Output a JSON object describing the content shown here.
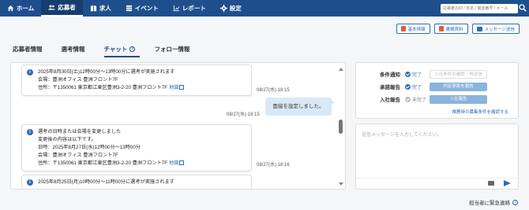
{
  "nav": {
    "items": [
      {
        "label": "ホーム",
        "icon": "home-icon"
      },
      {
        "label": "応募者",
        "icon": "people-icon",
        "active": true
      },
      {
        "label": "求人",
        "icon": "book-icon"
      },
      {
        "label": "イベント",
        "icon": "list-icon"
      },
      {
        "label": "レポート",
        "icon": "chart-icon"
      },
      {
        "label": "設定",
        "icon": "gear-icon"
      }
    ],
    "search_placeholder": "応募者のID / 氏名 / 電話番号 / メール"
  },
  "top_buttons": {
    "basic_info": "基本情報",
    "application_docs": "書類資料",
    "send_message": "メッセージ送信"
  },
  "tabs": {
    "applicant_info": "応募者情報",
    "selection_info": "選考情報",
    "chat": "チャット",
    "follow_info": "フォロー情報"
  },
  "chat": {
    "msg1": {
      "line1": "2025年8月30日(土)12時00分～13時00分に選考が実施されます",
      "line2": "会場：豊洲オフィス 豊洲フロント7F",
      "line3": "住所：〒1350061 東京都江東区豊洲3-2-20 豊洲フロント7F",
      "map": "地図",
      "time": "08/27(水) 18:15"
    },
    "bubble": {
      "text": "面接を設定しました。",
      "time": "08/27(水) 18:15"
    },
    "msg2": {
      "line1": "選考の日時または会場を変更しました",
      "line2": "変更後の内容は以下です。",
      "line3": "日時：2025年8月27日(水)12時00分～13時00分",
      "line4": "会場：豊洲オフィス 豊洲フロント7F",
      "line5": "住所：〒1350061 東京都江東区豊洲3-2-20 豊洲フロント7F",
      "map": "地図",
      "time": "08/27(水) 18:16"
    },
    "msg3": {
      "line1": "2025年8月25日(月)10時00分～11時00分に選考が実施されます"
    }
  },
  "status": {
    "rows": [
      {
        "label": "条件通知",
        "state": "完了",
        "done": true,
        "button": "入社条件の確認・再送信",
        "enabled": false
      },
      {
        "label": "承諾報告",
        "state": "完了",
        "done": true,
        "button": "内定承諾を報告",
        "enabled": true
      },
      {
        "label": "入社報告",
        "state": "未完了",
        "done": false,
        "button": "入社報告",
        "enabled": true
      }
    ],
    "link": "推薦時の募集条件を確認する"
  },
  "message_input": {
    "placeholder": "送信メッセージを入力してください。"
  },
  "emergency": "担当者に緊急連絡"
}
